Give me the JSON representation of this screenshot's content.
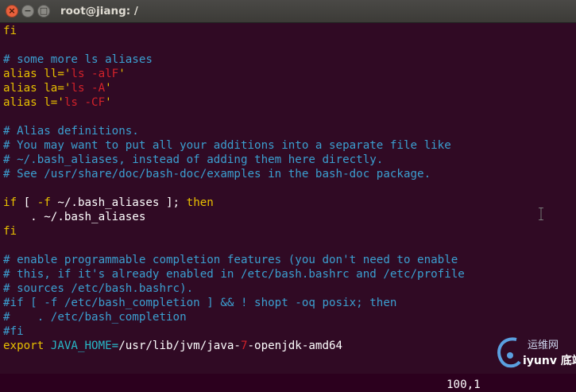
{
  "window": {
    "title": "root@jiang: /",
    "close_glyph": "×",
    "minimize_glyph": "−",
    "maximize_glyph": "□"
  },
  "terminal": {
    "colors": {
      "background": "#300a24",
      "comment": "#3b9fd0",
      "keyword": "#e8c000",
      "string": "#d2222a",
      "text": "#ffffff"
    },
    "lines": [
      {
        "segs": [
          {
            "t": "fi",
            "c": "k"
          }
        ]
      },
      {
        "segs": []
      },
      {
        "segs": [
          {
            "t": "# some more ls aliases",
            "c": "c"
          }
        ]
      },
      {
        "segs": [
          {
            "t": "alias ll=",
            "c": "k"
          },
          {
            "t": "'",
            "c": "k"
          },
          {
            "t": "ls -alF",
            "c": "s"
          },
          {
            "t": "'",
            "c": "k"
          }
        ]
      },
      {
        "segs": [
          {
            "t": "alias la=",
            "c": "k"
          },
          {
            "t": "'",
            "c": "k"
          },
          {
            "t": "ls -A",
            "c": "s"
          },
          {
            "t": "'",
            "c": "k"
          }
        ]
      },
      {
        "segs": [
          {
            "t": "alias l=",
            "c": "k"
          },
          {
            "t": "'",
            "c": "k"
          },
          {
            "t": "ls -CF",
            "c": "s"
          },
          {
            "t": "'",
            "c": "k"
          }
        ]
      },
      {
        "segs": []
      },
      {
        "segs": [
          {
            "t": "# Alias definitions.",
            "c": "c"
          }
        ]
      },
      {
        "segs": [
          {
            "t": "# You may want to put all your additions into a separate file like",
            "c": "c"
          }
        ]
      },
      {
        "segs": [
          {
            "t": "# ~/.bash_aliases, instead of adding them here directly.",
            "c": "c"
          }
        ]
      },
      {
        "segs": [
          {
            "t": "# See /usr/share/doc/bash-doc/examples in the bash-doc package.",
            "c": "c"
          }
        ]
      },
      {
        "segs": []
      },
      {
        "segs": [
          {
            "t": "if",
            "c": "k"
          },
          {
            "t": " [ ",
            "c": "b"
          },
          {
            "t": "-f",
            "c": "k"
          },
          {
            "t": " ~/.bash_aliases ]; ",
            "c": "b"
          },
          {
            "t": "then",
            "c": "k"
          }
        ]
      },
      {
        "segs": [
          {
            "t": "    . ~/.bash_aliases",
            "c": "b"
          }
        ]
      },
      {
        "segs": [
          {
            "t": "fi",
            "c": "k"
          }
        ]
      },
      {
        "segs": []
      },
      {
        "segs": [
          {
            "t": "# enable programmable completion features (you don't need to enable",
            "c": "c"
          }
        ]
      },
      {
        "segs": [
          {
            "t": "# this, if it's already enabled in /etc/bash.bashrc and /etc/profile",
            "c": "c"
          }
        ]
      },
      {
        "segs": [
          {
            "t": "# sources /etc/bash.bashrc).",
            "c": "c"
          }
        ]
      },
      {
        "segs": [
          {
            "t": "#if [ -f /etc/bash_completion ] && ! shopt -oq posix; then",
            "c": "c"
          }
        ]
      },
      {
        "segs": [
          {
            "t": "#    . /etc/bash_completion",
            "c": "c"
          }
        ]
      },
      {
        "segs": [
          {
            "t": "#fi",
            "c": "c"
          }
        ]
      },
      {
        "segs": [
          {
            "t": "export",
            "c": "k"
          },
          {
            "t": " JAVA_HOME=",
            "c": "g"
          },
          {
            "t": "/usr/lib/jvm/java-",
            "c": "b"
          },
          {
            "t": "7",
            "c": "s"
          },
          {
            "t": "-openjdk-amd64",
            "c": "b"
          }
        ]
      }
    ],
    "status": "100,1",
    "status_suffix": "底端"
  },
  "watermark": {
    "brand_cn": "运维网",
    "brand_en": "iyunv"
  }
}
